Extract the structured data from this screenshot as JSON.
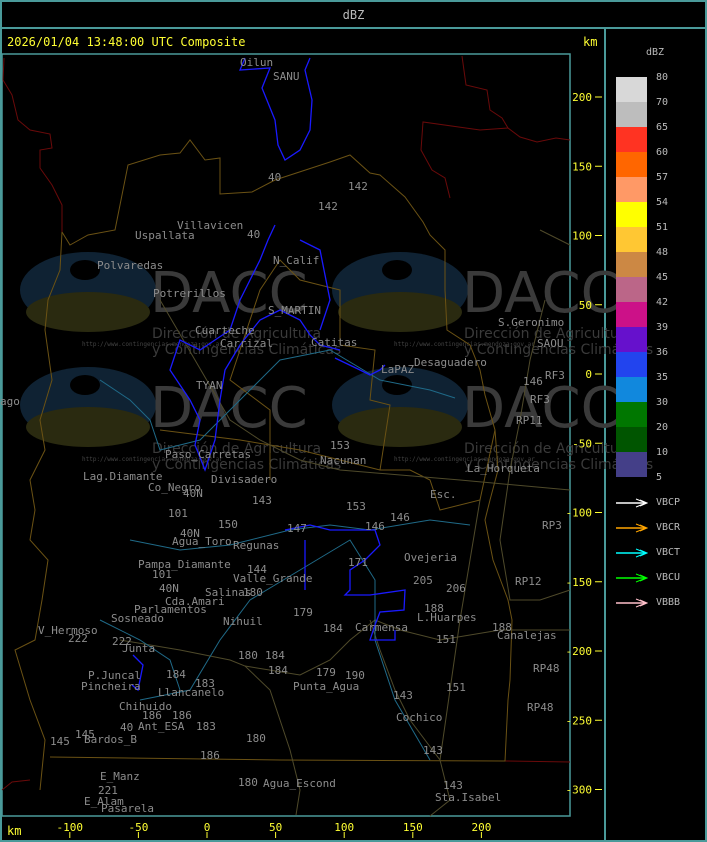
{
  "header": {
    "title": "dBZ"
  },
  "map": {
    "timestamp": "2026/01/04 13:48:00 UTC Composite",
    "unit_top": "km",
    "unit_bottom": "km",
    "x_ticks": [
      -100,
      -50,
      0,
      50,
      100,
      150,
      200
    ],
    "y_ticks": [
      200,
      150,
      100,
      50,
      0,
      -50,
      -100,
      -150,
      -200,
      -250,
      -300
    ],
    "watermark": {
      "logo_text": "DACC",
      "line1": "Dirección de Agricultura",
      "line2": "y Contingencias Climáticas",
      "url": "http://www.contingencias.mendoza.gov.ar"
    },
    "place_labels": [
      "Oilun",
      "SANU",
      "40",
      "142",
      "142",
      "Villavicen",
      "Uspallata",
      "40",
      "N_Calif",
      "Polvaredas",
      "Potrerillos",
      "S_MARTIN",
      "Cuarteche",
      "Carrizal",
      "Catitas",
      "LaPAZ",
      "Desaguadero",
      "S.Geronimo",
      "SAOU",
      "146",
      "RF3",
      "RF3",
      "RP11",
      "153",
      "Nacunan",
      "La_Horqueta",
      "TYAN",
      "Paso_Carretas",
      "Lag.Diamante",
      "Co_Negro",
      "Divisadero",
      "40N",
      "143",
      "Esc.",
      "153",
      "146",
      "146",
      "101",
      "150",
      "40N",
      "Agua_Toro",
      "Regunas",
      "147",
      "Ovejeria",
      "205",
      "206",
      "171",
      "Pampa_Diamante",
      "101",
      "144",
      "Valle_Grande",
      "40N",
      "Salinas",
      "180",
      "Cda.Amari",
      "Parlamentos",
      "RP12",
      "Sosneado",
      "179",
      "Nihuil",
      "L.Huarpes",
      "188",
      "184",
      "Carmensa",
      "V_Hermoso",
      "222",
      "188",
      "Canalejas",
      "222",
      "Junta",
      "151",
      "180",
      "184",
      "184",
      "P.Juncal",
      "184",
      "179",
      "190",
      "Pincheira",
      "Llancanelo",
      "183",
      "Punta_Agua",
      "RP48",
      "151",
      "Chihuido",
      "143",
      "186",
      "186",
      "40",
      "Ant_ESA",
      "183",
      "RP48",
      "Cochico",
      "145",
      "145",
      "Bardos_B",
      "180",
      "186",
      "143",
      "E_Manz",
      "221",
      "180",
      "Agua_Escond",
      "143",
      "E_Alam",
      "Pasarela",
      "Sta.Isabel",
      "ago",
      "RP3"
    ]
  },
  "legend": {
    "title": "dBZ",
    "scale": [
      {
        "label": "80",
        "color": "#d8d8d8"
      },
      {
        "label": "70",
        "color": "#bdbdbd"
      },
      {
        "label": "65",
        "color": "#ff3322"
      },
      {
        "label": "60",
        "color": "#ff6600"
      },
      {
        "label": "57",
        "color": "#ff9966"
      },
      {
        "label": "54",
        "color": "#ffff00"
      },
      {
        "label": "51",
        "color": "#ffc733"
      },
      {
        "label": "48",
        "color": "#cc8844"
      },
      {
        "label": "45",
        "color": "#bb6688"
      },
      {
        "label": "42",
        "color": "#cc1188"
      },
      {
        "label": "39",
        "color": "#6611cc"
      },
      {
        "label": "36",
        "color": "#2244ee"
      },
      {
        "label": "35",
        "color": "#1188dd"
      },
      {
        "label": "30",
        "color": "#007700"
      },
      {
        "label": "20",
        "color": "#005500"
      },
      {
        "label": "10",
        "color": "#443f88"
      },
      {
        "label": "5",
        "color": ""
      }
    ],
    "radars": [
      {
        "name": "VBCP",
        "color": "#ffffff"
      },
      {
        "name": "VBCR",
        "color": "#ffa500"
      },
      {
        "name": "VBCT",
        "color": "#00ffff"
      },
      {
        "name": "VBCU",
        "color": "#00ff00"
      },
      {
        "name": "VBBB",
        "color": "#ffc0cb"
      }
    ]
  }
}
